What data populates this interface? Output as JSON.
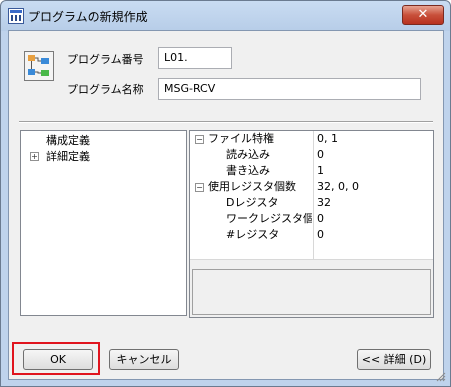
{
  "window": {
    "title": "プログラムの新規作成",
    "close_label": "✕"
  },
  "form": {
    "program_number_label": "プログラム番号",
    "program_number_value": "L01.",
    "program_name_label": "プログラム名称",
    "program_name_value": "MSG-RCV"
  },
  "tree": {
    "items": [
      {
        "label": "構成定義",
        "expander": ""
      },
      {
        "label": "詳細定義",
        "expander": "+"
      }
    ]
  },
  "properties": {
    "rows": [
      {
        "name": "ファイル特権",
        "value": "0, 1",
        "expander": "−"
      },
      {
        "name": "読み込み",
        "value": "0",
        "expander": ""
      },
      {
        "name": "書き込み",
        "value": "1",
        "expander": ""
      },
      {
        "name": "使用レジスタ個数",
        "value": "32, 0, 0",
        "expander": "−"
      },
      {
        "name": "Dレジスタ",
        "value": "32",
        "expander": ""
      },
      {
        "name": "ワークレジスタ個...",
        "value": "0",
        "expander": ""
      },
      {
        "name": "#レジスタ",
        "value": "0",
        "expander": ""
      }
    ]
  },
  "buttons": {
    "ok": "OK",
    "cancel": "キャンセル",
    "details": "<< 詳細 (D)"
  },
  "colors": {
    "highlight": "#e0141e",
    "title_bar": "#c9dcf2",
    "close_button": "#c8503a"
  }
}
